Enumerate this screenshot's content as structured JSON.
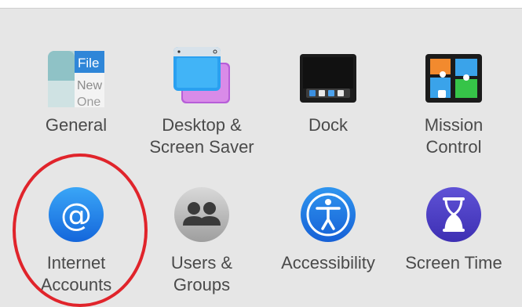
{
  "preferences": {
    "row1": [
      {
        "label": "General"
      },
      {
        "label": "Desktop &\nScreen Saver"
      },
      {
        "label": "Dock"
      },
      {
        "label": "Mission\nControl"
      }
    ],
    "row2": [
      {
        "label": "Internet\nAccounts"
      },
      {
        "label": "Users &\nGroups"
      },
      {
        "label": "Accessibility"
      },
      {
        "label": "Screen Time"
      }
    ]
  },
  "general_icon_text": {
    "line1": "File",
    "line2": "New",
    "line3": "One"
  },
  "annotation": {
    "shape": "ellipse",
    "color": "#e0242b"
  }
}
